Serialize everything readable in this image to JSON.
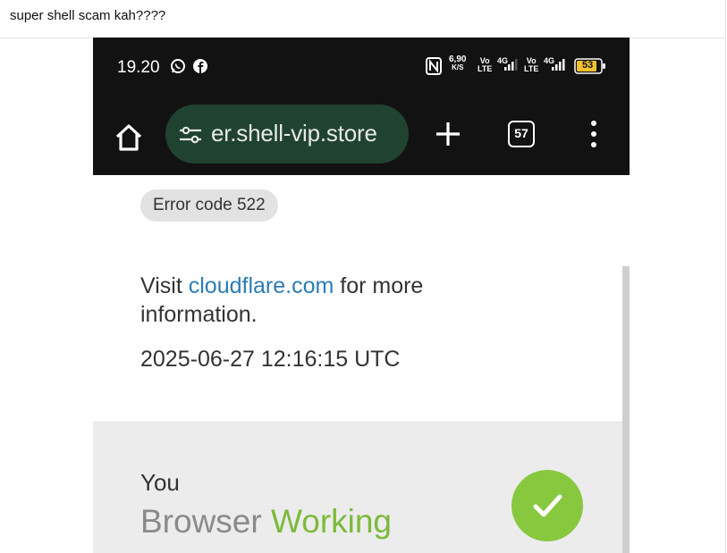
{
  "post": {
    "title": "super shell scam kah????"
  },
  "status_bar": {
    "time": "19.20",
    "speed_value": "6,90",
    "speed_unit": "K/S",
    "volte_label": "Vo",
    "lte_label": "LTE",
    "network_label": "4G",
    "battery": "53",
    "icons": [
      "whatsapp-icon",
      "facebook-icon",
      "nfc-icon",
      "signal-icon",
      "battery-icon"
    ]
  },
  "browser": {
    "url": "er.shell-vip.store",
    "tab_count": "57",
    "icons": [
      "home-icon",
      "site-settings-icon",
      "plus-icon",
      "more-vert-icon"
    ],
    "accent_color": "#1f4330"
  },
  "page": {
    "error_code": "Error code 522",
    "info_prefix": "Visit ",
    "info_link": "cloudflare.com",
    "info_suffix": " for more information.",
    "timestamp": "2025-06-27 12:16:15 UTC",
    "you_label": "You",
    "browser_label": "Browser",
    "status_word": "Working",
    "status_color": "#7cba3b",
    "status_icon": "checkmark-icon"
  }
}
